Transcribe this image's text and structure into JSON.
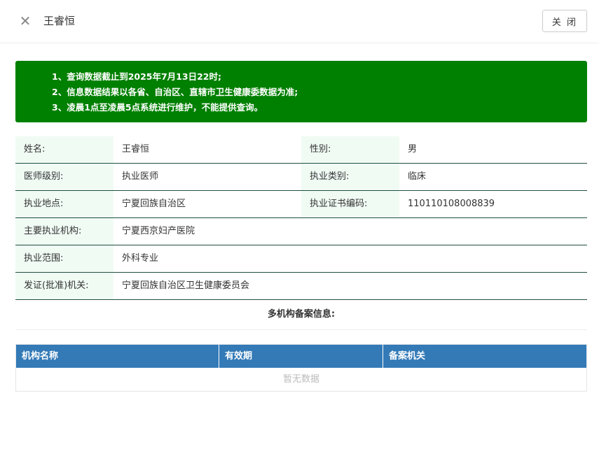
{
  "header": {
    "close_icon": "close-icon",
    "close_glyph": "✕",
    "title": "王睿恒",
    "close_button": "关 闭"
  },
  "notice": {
    "lines": [
      "1、查询数据截止到2025年7月13日22时;",
      "2、信息数据结果以各省、自治区、直辖市卫生健康委数据为准;",
      "3、凌晨1点至凌晨5点系统进行维护，不能提供查询。"
    ],
    "background": "#008000"
  },
  "info": {
    "name_label": "姓名:",
    "name_value": "王睿恒",
    "gender_label": "性别:",
    "gender_value": "男",
    "level_label": "医师级别:",
    "level_value": "执业医师",
    "category_label": "执业类别:",
    "category_value": "临床",
    "location_label": "执业地点:",
    "location_value": "宁夏回族自治区",
    "cert_label": "执业证书编码:",
    "cert_value": "110110108008839",
    "org_label": "主要执业机构:",
    "org_value": "宁夏西京妇产医院",
    "scope_label": "执业范围:",
    "scope_value": "外科专业",
    "issuer_label": "发证(批准)机关:",
    "issuer_value": "宁夏回族自治区卫生健康委员会"
  },
  "multi": {
    "title": "多机构备案信息:",
    "columns": [
      "机构名称",
      "有效期",
      "备案机关"
    ],
    "empty_text": "暂无数据",
    "header_color": "#337ab7"
  }
}
